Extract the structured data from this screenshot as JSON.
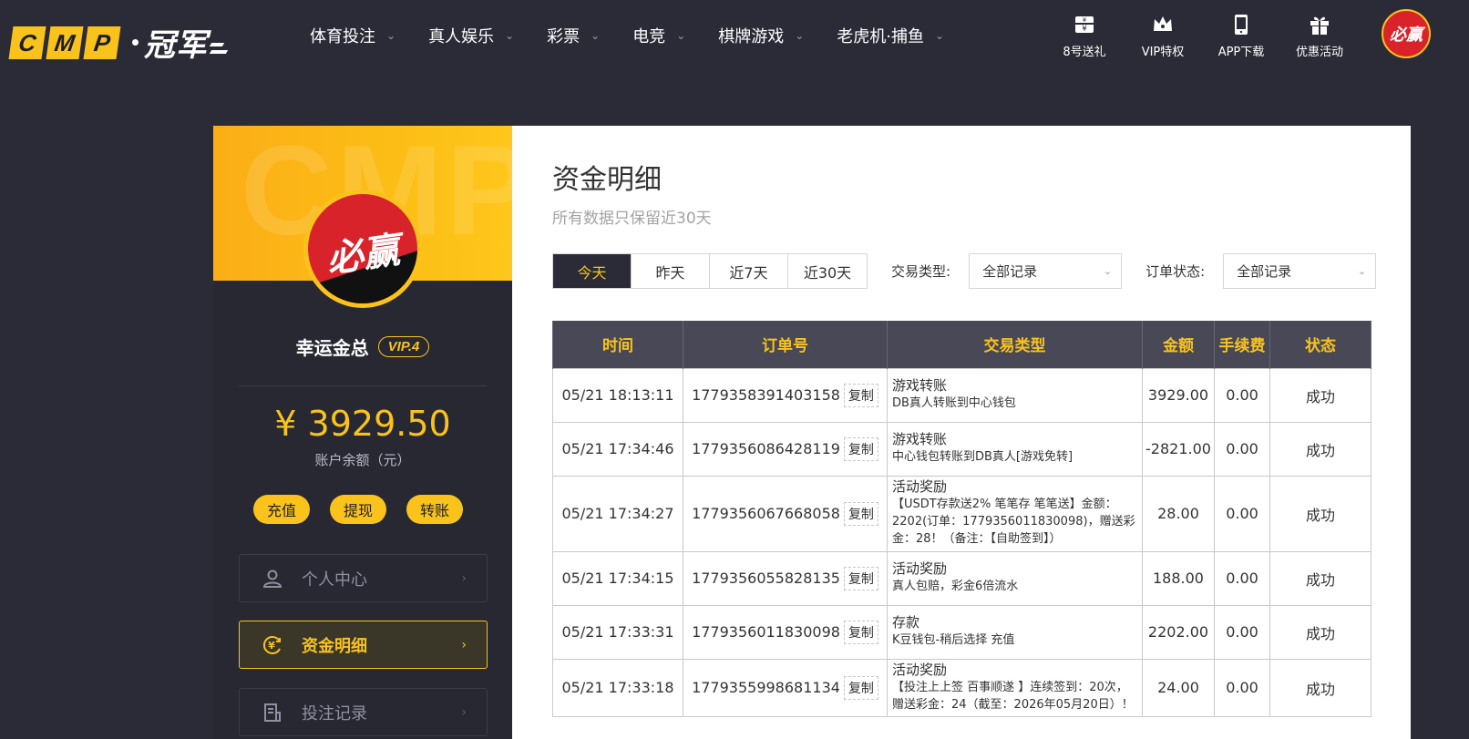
{
  "brand": {
    "cmp_letters": [
      "C",
      "M",
      "P"
    ],
    "name": "冠军"
  },
  "nav": [
    {
      "label": "体育投注"
    },
    {
      "label": "真人娱乐"
    },
    {
      "label": "彩票"
    },
    {
      "label": "电竞"
    },
    {
      "label": "棋牌游戏"
    },
    {
      "label": "老虎机·捕鱼"
    }
  ],
  "quick_links": [
    {
      "label": "8号送礼",
      "icon": "yen-gift-icon"
    },
    {
      "label": "VIP特权",
      "icon": "crown-icon"
    },
    {
      "label": "APP下载",
      "icon": "phone-icon"
    },
    {
      "label": "优惠活动",
      "icon": "gift-icon"
    }
  ],
  "user": {
    "avatar_text": "必赢",
    "watermark": "CMP",
    "name": "幸运金总",
    "vip": "VIP.4",
    "balance": "¥ 3929.50",
    "balance_label": "账户余额（元）"
  },
  "actions": {
    "deposit": "充值",
    "withdraw": "提现",
    "transfer": "转账"
  },
  "menu": [
    {
      "label": "个人中心",
      "icon": "user-icon",
      "active": false
    },
    {
      "label": "资金明细",
      "icon": "yen-circle-icon",
      "active": true
    },
    {
      "label": "投注记录",
      "icon": "receipt-icon",
      "active": false
    }
  ],
  "page": {
    "title": "资金明细",
    "subtitle": "所有数据只保留近30天"
  },
  "filters": {
    "tabs": [
      "今天",
      "昨天",
      "近7天",
      "近30天"
    ],
    "active_tab": "今天",
    "type_label": "交易类型:",
    "type_value": "全部记录",
    "status_label": "订单状态:",
    "status_value": "全部记录"
  },
  "table": {
    "headers": [
      "时间",
      "订单号",
      "交易类型",
      "金额",
      "手续费",
      "状态"
    ],
    "copy_label": "复制",
    "rows": [
      {
        "time": "05/21 18:13:11",
        "order": "1779358391403158",
        "type_title": "游戏转账",
        "type_desc": "DB真人转账到中心钱包",
        "amount": "3929.00",
        "fee": "0.00",
        "status": "成功"
      },
      {
        "time": "05/21 17:34:46",
        "order": "1779356086428119",
        "type_title": "游戏转账",
        "type_desc": "中心钱包转账到DB真人[游戏免转]",
        "amount": "-2821.00",
        "fee": "0.00",
        "status": "成功"
      },
      {
        "time": "05/21 17:34:27",
        "order": "1779356067668058",
        "type_title": "活动奖励",
        "type_desc": "【USDT存款送2% 笔笔存 笔笔送】金额：2202(订单：1779356011830098)，赠送彩金：28！（备注：【自助签到】）",
        "amount": "28.00",
        "fee": "0.00",
        "status": "成功"
      },
      {
        "time": "05/21 17:34:15",
        "order": "1779356055828135",
        "type_title": "活动奖励",
        "type_desc": "真人包赔，彩金6倍流水",
        "amount": "188.00",
        "fee": "0.00",
        "status": "成功"
      },
      {
        "time": "05/21 17:33:31",
        "order": "1779356011830098",
        "type_title": "存款",
        "type_desc": "K豆钱包-稍后选择 充值",
        "amount": "2202.00",
        "fee": "0.00",
        "status": "成功"
      },
      {
        "time": "05/21 17:33:18",
        "order": "1779355998681134",
        "type_title": "活动奖励",
        "type_desc": "【投注上上签 百事顺遂 】连续签到：20次，赠送彩金：24（截至：2026年05月20日）！",
        "amount": "24.00",
        "fee": "0.00",
        "status": "成功"
      }
    ]
  },
  "colors": {
    "accent": "#f9c31c",
    "page_bg": "#2a2b36",
    "success": "#2e9b2e"
  }
}
